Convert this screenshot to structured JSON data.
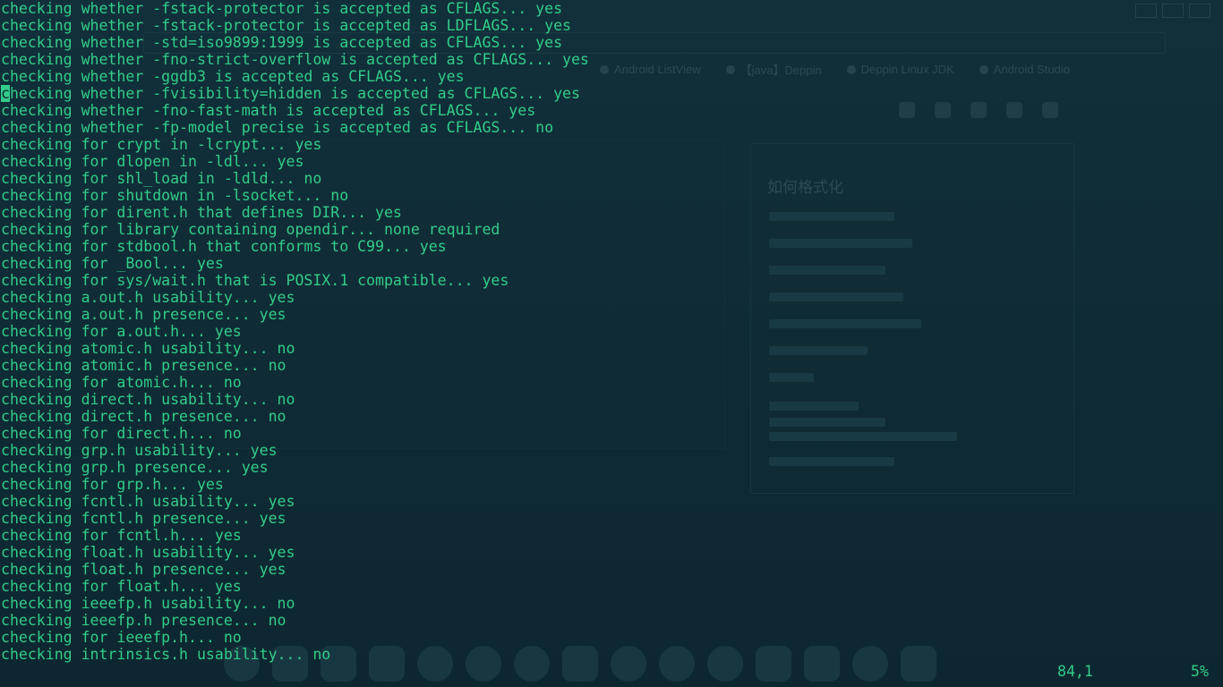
{
  "terminal": {
    "cursor_line_index": 5,
    "lines": [
      "checking whether -fstack-protector is accepted as CFLAGS... yes",
      "checking whether -fstack-protector is accepted as LDFLAGS... yes",
      "checking whether -std=iso9899:1999 is accepted as CFLAGS... yes",
      "checking whether -fno-strict-overflow is accepted as CFLAGS... yes",
      "checking whether -ggdb3 is accepted as CFLAGS... yes",
      "checking whether -fvisibility=hidden is accepted as CFLAGS... yes",
      "checking whether -fno-fast-math is accepted as CFLAGS... yes",
      "checking whether -fp-model precise is accepted as CFLAGS... no",
      "checking for crypt in -lcrypt... yes",
      "checking for dlopen in -ldl... yes",
      "checking for shl_load in -ldld... no",
      "checking for shutdown in -lsocket... no",
      "checking for dirent.h that defines DIR... yes",
      "checking for library containing opendir... none required",
      "checking for stdbool.h that conforms to C99... yes",
      "checking for _Bool... yes",
      "checking for sys/wait.h that is POSIX.1 compatible... yes",
      "checking a.out.h usability... yes",
      "checking a.out.h presence... yes",
      "checking for a.out.h... yes",
      "checking atomic.h usability... no",
      "checking atomic.h presence... no",
      "checking for atomic.h... no",
      "checking direct.h usability... no",
      "checking direct.h presence... no",
      "checking for direct.h... no",
      "checking grp.h usability... yes",
      "checking grp.h presence... yes",
      "checking for grp.h... yes",
      "checking fcntl.h usability... yes",
      "checking fcntl.h presence... yes",
      "checking for fcntl.h... yes",
      "checking float.h usability... yes",
      "checking float.h presence... yes",
      "checking for float.h... yes",
      "checking ieeefp.h usability... no",
      "checking ieeefp.h presence... no",
      "checking for ieeefp.h... no",
      "checking intrinsics.h usability... no"
    ],
    "text_color": "#33cc8a",
    "background_color": "#0f2a33"
  },
  "status": {
    "position": "84,1",
    "percent": "5%"
  },
  "background": {
    "tabs": [
      "Android ListView",
      "【java】Deppin",
      "Deppin Linux JDK",
      "Android Studio"
    ],
    "panel_title": "如何格式化"
  }
}
